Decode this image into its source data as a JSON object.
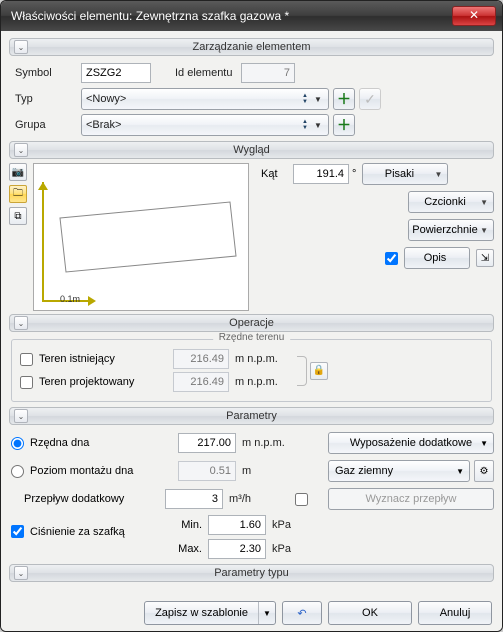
{
  "window": {
    "title": "Właściwości elementu: Zewnętrzna szafka gazowa *"
  },
  "sections": {
    "manage": "Zarządzanie elementem",
    "look": "Wygląd",
    "ops": "Operacje",
    "terrain_legend": "Rzędne terenu",
    "params": "Parametry",
    "type_params": "Parametry typu"
  },
  "manage": {
    "symbol_label": "Symbol",
    "symbol_value": "ZSZG2",
    "id_label": "Id elementu",
    "id_value": "7",
    "type_label": "Typ",
    "type_value": "<Nowy>",
    "group_label": "Grupa",
    "group_value": "<Brak>"
  },
  "look": {
    "angle_label": "Kąt",
    "angle_value": "191.4",
    "angle_unit": "°",
    "btn_pens": "Pisaki",
    "btn_fonts": "Czcionki",
    "btn_surfaces": "Powierzchnie",
    "btn_desc": "Opis",
    "scale": "0.1m"
  },
  "terrain": {
    "existing_label": "Teren istniejący",
    "existing_value": "216.49",
    "projected_label": "Teren projektowany",
    "projected_value": "216.49",
    "unit": "m n.p.m."
  },
  "params": {
    "rzedna_label": "Rzędna dna",
    "rzedna_value": "217.00",
    "rzedna_unit": "m n.p.m.",
    "poziom_label": "Poziom montażu dna",
    "poziom_value": "0.51",
    "poziom_unit": "m",
    "wypos_label": "Wyposażenie dodatkowe",
    "gas_label": "Gaz ziemny",
    "flow_label": "Przepływ dodatkowy",
    "flow_value": "3",
    "flow_unit": "m³/h",
    "flow_btn": "Wyznacz przepływ",
    "pressure_label": "Ciśnienie za szafką",
    "min_label": "Min.",
    "min_value": "1.60",
    "max_label": "Max.",
    "max_value": "2.30",
    "p_unit": "kPa"
  },
  "footer": {
    "save_tpl": "Zapisz w szablonie",
    "ok": "OK",
    "cancel": "Anuluj"
  }
}
